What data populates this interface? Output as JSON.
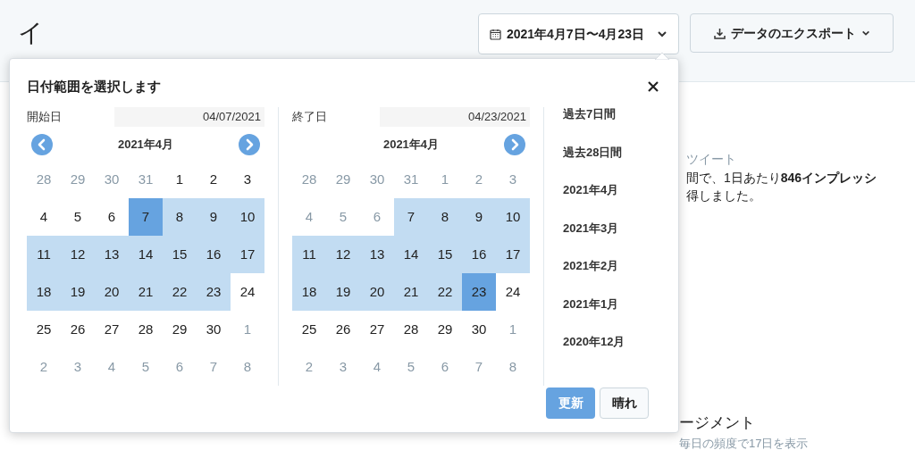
{
  "page_title": "イ",
  "date_range_button": "2021年4月7日〜4月23日",
  "export_button": "データのエクスポート",
  "background": {
    "section_label": "ツイート",
    "summary_lines": [
      "間で、1日あたり**846インプレッシ**",
      "得しました。"
    ],
    "engagement_title": "ージメント",
    "engagement_note": "毎日の頻度で17日を表示"
  },
  "popup": {
    "title": "日付範囲を選択します",
    "calendars": [
      {
        "label": "開始日",
        "value": "04/07/2021",
        "month": "2021年4月",
        "prev_arrow": true,
        "next_arrow": true,
        "weeks": [
          [
            {
              "d": "28",
              "muted": true,
              "in_range": false,
              "endpoint": false
            },
            {
              "d": "29",
              "muted": true,
              "in_range": false,
              "endpoint": false
            },
            {
              "d": "30",
              "muted": true,
              "in_range": false,
              "endpoint": false
            },
            {
              "d": "31",
              "muted": true,
              "in_range": false,
              "endpoint": false
            },
            {
              "d": "1",
              "muted": false,
              "in_range": false,
              "endpoint": false
            },
            {
              "d": "2",
              "muted": false,
              "in_range": false,
              "endpoint": false
            },
            {
              "d": "3",
              "muted": false,
              "in_range": false,
              "endpoint": false
            }
          ],
          [
            {
              "d": "4",
              "muted": false,
              "in_range": false,
              "endpoint": false
            },
            {
              "d": "5",
              "muted": false,
              "in_range": false,
              "endpoint": false
            },
            {
              "d": "6",
              "muted": false,
              "in_range": false,
              "endpoint": false
            },
            {
              "d": "7",
              "muted": false,
              "in_range": true,
              "endpoint": true
            },
            {
              "d": "8",
              "muted": false,
              "in_range": true,
              "endpoint": false
            },
            {
              "d": "9",
              "muted": false,
              "in_range": true,
              "endpoint": false
            },
            {
              "d": "10",
              "muted": false,
              "in_range": true,
              "endpoint": false
            }
          ],
          [
            {
              "d": "11",
              "muted": false,
              "in_range": true,
              "endpoint": false
            },
            {
              "d": "12",
              "muted": false,
              "in_range": true,
              "endpoint": false
            },
            {
              "d": "13",
              "muted": false,
              "in_range": true,
              "endpoint": false
            },
            {
              "d": "14",
              "muted": false,
              "in_range": true,
              "endpoint": false
            },
            {
              "d": "15",
              "muted": false,
              "in_range": true,
              "endpoint": false
            },
            {
              "d": "16",
              "muted": false,
              "in_range": true,
              "endpoint": false
            },
            {
              "d": "17",
              "muted": false,
              "in_range": true,
              "endpoint": false
            }
          ],
          [
            {
              "d": "18",
              "muted": false,
              "in_range": true,
              "endpoint": false
            },
            {
              "d": "19",
              "muted": false,
              "in_range": true,
              "endpoint": false
            },
            {
              "d": "20",
              "muted": false,
              "in_range": true,
              "endpoint": false
            },
            {
              "d": "21",
              "muted": false,
              "in_range": true,
              "endpoint": false
            },
            {
              "d": "22",
              "muted": false,
              "in_range": true,
              "endpoint": false
            },
            {
              "d": "23",
              "muted": false,
              "in_range": true,
              "endpoint": false
            },
            {
              "d": "24",
              "muted": false,
              "in_range": false,
              "endpoint": false
            }
          ],
          [
            {
              "d": "25",
              "muted": false,
              "in_range": false,
              "endpoint": false
            },
            {
              "d": "26",
              "muted": false,
              "in_range": false,
              "endpoint": false
            },
            {
              "d": "27",
              "muted": false,
              "in_range": false,
              "endpoint": false
            },
            {
              "d": "28",
              "muted": false,
              "in_range": false,
              "endpoint": false
            },
            {
              "d": "29",
              "muted": false,
              "in_range": false,
              "endpoint": false
            },
            {
              "d": "30",
              "muted": false,
              "in_range": false,
              "endpoint": false
            },
            {
              "d": "1",
              "muted": true,
              "in_range": false,
              "endpoint": false
            }
          ],
          [
            {
              "d": "2",
              "muted": true,
              "in_range": false,
              "endpoint": false
            },
            {
              "d": "3",
              "muted": true,
              "in_range": false,
              "endpoint": false
            },
            {
              "d": "4",
              "muted": true,
              "in_range": false,
              "endpoint": false
            },
            {
              "d": "5",
              "muted": true,
              "in_range": false,
              "endpoint": false
            },
            {
              "d": "6",
              "muted": true,
              "in_range": false,
              "endpoint": false
            },
            {
              "d": "7",
              "muted": true,
              "in_range": false,
              "endpoint": false
            },
            {
              "d": "8",
              "muted": true,
              "in_range": false,
              "endpoint": false
            }
          ]
        ]
      },
      {
        "label": "終了日",
        "value": "04/23/2021",
        "month": "2021年4月",
        "prev_arrow": false,
        "next_arrow": true,
        "weeks": [
          [
            {
              "d": "28",
              "muted": true,
              "in_range": false,
              "endpoint": false
            },
            {
              "d": "29",
              "muted": true,
              "in_range": false,
              "endpoint": false
            },
            {
              "d": "30",
              "muted": true,
              "in_range": false,
              "endpoint": false
            },
            {
              "d": "31",
              "muted": true,
              "in_range": false,
              "endpoint": false
            },
            {
              "d": "1",
              "muted": true,
              "in_range": false,
              "endpoint": false
            },
            {
              "d": "2",
              "muted": true,
              "in_range": false,
              "endpoint": false
            },
            {
              "d": "3",
              "muted": true,
              "in_range": false,
              "endpoint": false
            }
          ],
          [
            {
              "d": "4",
              "muted": true,
              "in_range": false,
              "endpoint": false
            },
            {
              "d": "5",
              "muted": true,
              "in_range": false,
              "endpoint": false
            },
            {
              "d": "6",
              "muted": true,
              "in_range": false,
              "endpoint": false
            },
            {
              "d": "7",
              "muted": false,
              "in_range": true,
              "endpoint": false
            },
            {
              "d": "8",
              "muted": false,
              "in_range": true,
              "endpoint": false
            },
            {
              "d": "9",
              "muted": false,
              "in_range": true,
              "endpoint": false
            },
            {
              "d": "10",
              "muted": false,
              "in_range": true,
              "endpoint": false
            }
          ],
          [
            {
              "d": "11",
              "muted": false,
              "in_range": true,
              "endpoint": false
            },
            {
              "d": "12",
              "muted": false,
              "in_range": true,
              "endpoint": false
            },
            {
              "d": "13",
              "muted": false,
              "in_range": true,
              "endpoint": false
            },
            {
              "d": "14",
              "muted": false,
              "in_range": true,
              "endpoint": false
            },
            {
              "d": "15",
              "muted": false,
              "in_range": true,
              "endpoint": false
            },
            {
              "d": "16",
              "muted": false,
              "in_range": true,
              "endpoint": false
            },
            {
              "d": "17",
              "muted": false,
              "in_range": true,
              "endpoint": false
            }
          ],
          [
            {
              "d": "18",
              "muted": false,
              "in_range": true,
              "endpoint": false
            },
            {
              "d": "19",
              "muted": false,
              "in_range": true,
              "endpoint": false
            },
            {
              "d": "20",
              "muted": false,
              "in_range": true,
              "endpoint": false
            },
            {
              "d": "21",
              "muted": false,
              "in_range": true,
              "endpoint": false
            },
            {
              "d": "22",
              "muted": false,
              "in_range": true,
              "endpoint": false
            },
            {
              "d": "23",
              "muted": false,
              "in_range": true,
              "endpoint": true
            },
            {
              "d": "24",
              "muted": false,
              "in_range": false,
              "endpoint": false
            }
          ],
          [
            {
              "d": "25",
              "muted": false,
              "in_range": false,
              "endpoint": false
            },
            {
              "d": "26",
              "muted": false,
              "in_range": false,
              "endpoint": false
            },
            {
              "d": "27",
              "muted": false,
              "in_range": false,
              "endpoint": false
            },
            {
              "d": "28",
              "muted": false,
              "in_range": false,
              "endpoint": false
            },
            {
              "d": "29",
              "muted": false,
              "in_range": false,
              "endpoint": false
            },
            {
              "d": "30",
              "muted": false,
              "in_range": false,
              "endpoint": false
            },
            {
              "d": "1",
              "muted": true,
              "in_range": false,
              "endpoint": false
            }
          ],
          [
            {
              "d": "2",
              "muted": true,
              "in_range": false,
              "endpoint": false
            },
            {
              "d": "3",
              "muted": true,
              "in_range": false,
              "endpoint": false
            },
            {
              "d": "4",
              "muted": true,
              "in_range": false,
              "endpoint": false
            },
            {
              "d": "5",
              "muted": true,
              "in_range": false,
              "endpoint": false
            },
            {
              "d": "6",
              "muted": true,
              "in_range": false,
              "endpoint": false
            },
            {
              "d": "7",
              "muted": true,
              "in_range": false,
              "endpoint": false
            },
            {
              "d": "8",
              "muted": true,
              "in_range": false,
              "endpoint": false
            }
          ]
        ]
      }
    ],
    "presets": [
      "過去7日間",
      "過去28日間",
      "2021年4月",
      "2021年3月",
      "2021年2月",
      "2021年1月",
      "2020年12月"
    ],
    "update_button": "更新",
    "clear_button": "晴れ"
  }
}
